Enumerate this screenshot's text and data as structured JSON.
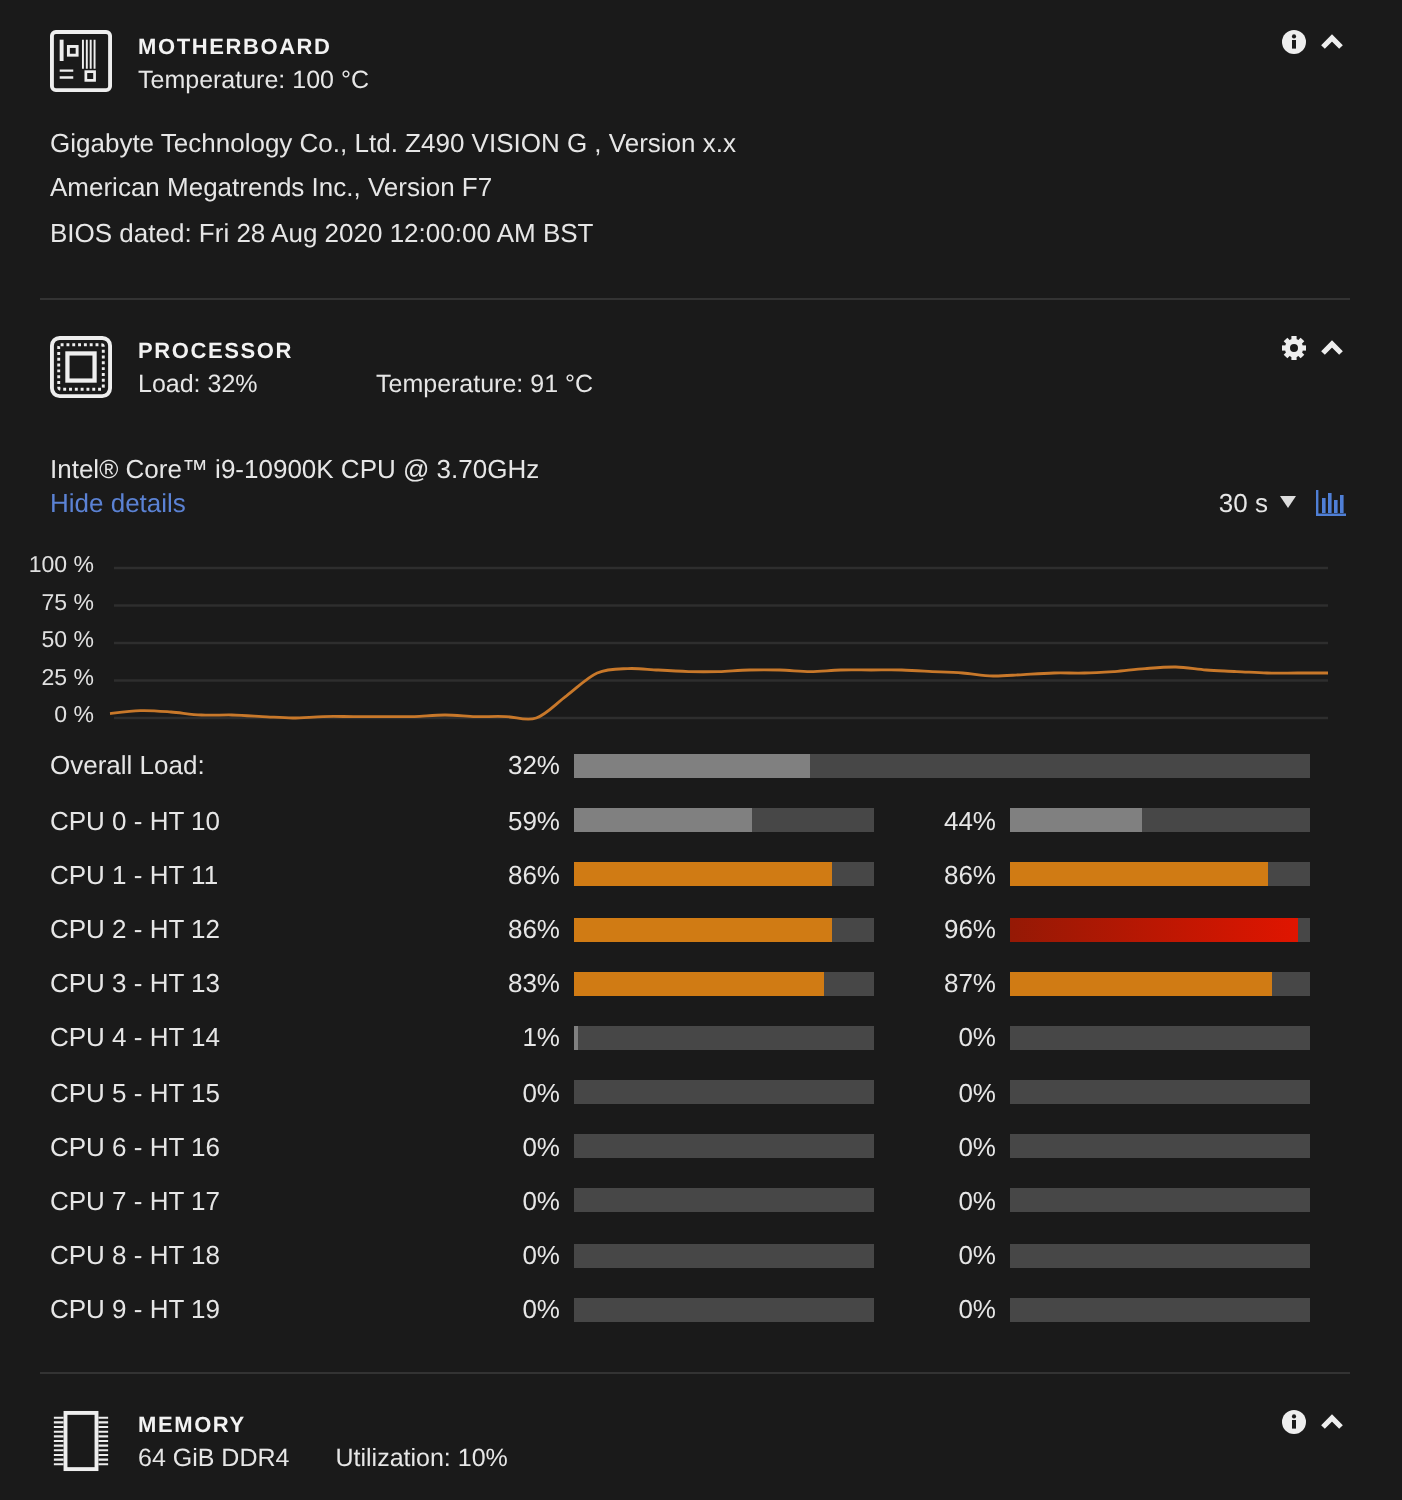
{
  "sections": [
    {
      "kind": "motherboard",
      "title": "MOTHERBOARD",
      "expanded": true,
      "stats": [
        "Temperature: 100 °C"
      ],
      "details": [
        "Gigabyte Technology Co., Ltd. Z490 VISION G , Version x.x",
        "American Megatrends Inc., Version F7",
        "BIOS dated: Fri 28 Aug 2020 12:00:00 AM BST"
      ]
    },
    {
      "kind": "processor",
      "title": "PROCESSOR",
      "expanded": true,
      "stats": [
        "Load: 32%",
        "Temperature: 91 °C"
      ],
      "model": "Intel® Core™ i9-10900K CPU @ 3.70GHz",
      "details_link": "Hide details",
      "interval": "30 s",
      "chart_data": {
        "type": "line",
        "grid": true,
        "ylim": [
          0,
          100
        ],
        "yticks": [
          {
            "value": 100,
            "label": "100 %"
          },
          {
            "value": 75,
            "label": "75 %"
          },
          {
            "value": 50,
            "label": "50 %"
          },
          {
            "value": 25,
            "label": "25 %"
          },
          {
            "value": 0,
            "label": "0 %"
          }
        ],
        "series": [
          {
            "color": "#c8782a",
            "values": [
              3,
              5,
              4,
              2,
              2,
              1,
              0,
              1,
              1,
              1,
              1,
              2,
              1,
              1,
              0,
              15,
              30,
              33,
              32,
              31,
              31,
              32,
              32,
              31,
              32,
              32,
              32,
              31,
              30,
              28,
              29,
              30,
              30,
              31,
              33,
              34,
              32,
              31,
              30,
              30,
              30
            ]
          }
        ]
      },
      "overall": {
        "label": "Overall Load:",
        "reading": "32%",
        "level": 0.32
      },
      "cores": [
        {
          "label": "CPU 0 - HT 10",
          "threads": [
            {
              "reading": "59%",
              "level": 0.59
            },
            {
              "reading": "44%",
              "level": 0.44
            }
          ]
        },
        {
          "label": "CPU 1 - HT 11",
          "threads": [
            {
              "reading": "86%",
              "level": 0.86
            },
            {
              "reading": "86%",
              "level": 0.86
            }
          ]
        },
        {
          "label": "CPU 2 - HT 12",
          "threads": [
            {
              "reading": "86%",
              "level": 0.86
            },
            {
              "reading": "96%",
              "level": 0.96
            }
          ]
        },
        {
          "label": "CPU 3 - HT 13",
          "threads": [
            {
              "reading": "83%",
              "level": 0.83
            },
            {
              "reading": "87%",
              "level": 0.87
            }
          ]
        },
        {
          "label": "CPU 4 - HT 14",
          "threads": [
            {
              "reading": "1%",
              "level": 0.01
            },
            {
              "reading": "0%",
              "level": 0
            }
          ]
        },
        {
          "label": "CPU 5 - HT 15",
          "threads": [
            {
              "reading": "0%",
              "level": 0
            },
            {
              "reading": "0%",
              "level": 0
            }
          ]
        },
        {
          "label": "CPU 6 - HT 16",
          "threads": [
            {
              "reading": "0%",
              "level": 0
            },
            {
              "reading": "0%",
              "level": 0
            }
          ]
        },
        {
          "label": "CPU 7 - HT 17",
          "threads": [
            {
              "reading": "0%",
              "level": 0
            },
            {
              "reading": "0%",
              "level": 0
            }
          ]
        },
        {
          "label": "CPU 8 - HT 18",
          "threads": [
            {
              "reading": "0%",
              "level": 0
            },
            {
              "reading": "0%",
              "level": 0
            }
          ]
        },
        {
          "label": "CPU 9 - HT 19",
          "threads": [
            {
              "reading": "0%",
              "level": 0
            },
            {
              "reading": "0%",
              "level": 0
            }
          ]
        }
      ]
    },
    {
      "kind": "memory",
      "title": "MEMORY",
      "expanded": true,
      "stats": [
        "64 GiB DDR4",
        "Utilization: 10%"
      ]
    }
  ]
}
